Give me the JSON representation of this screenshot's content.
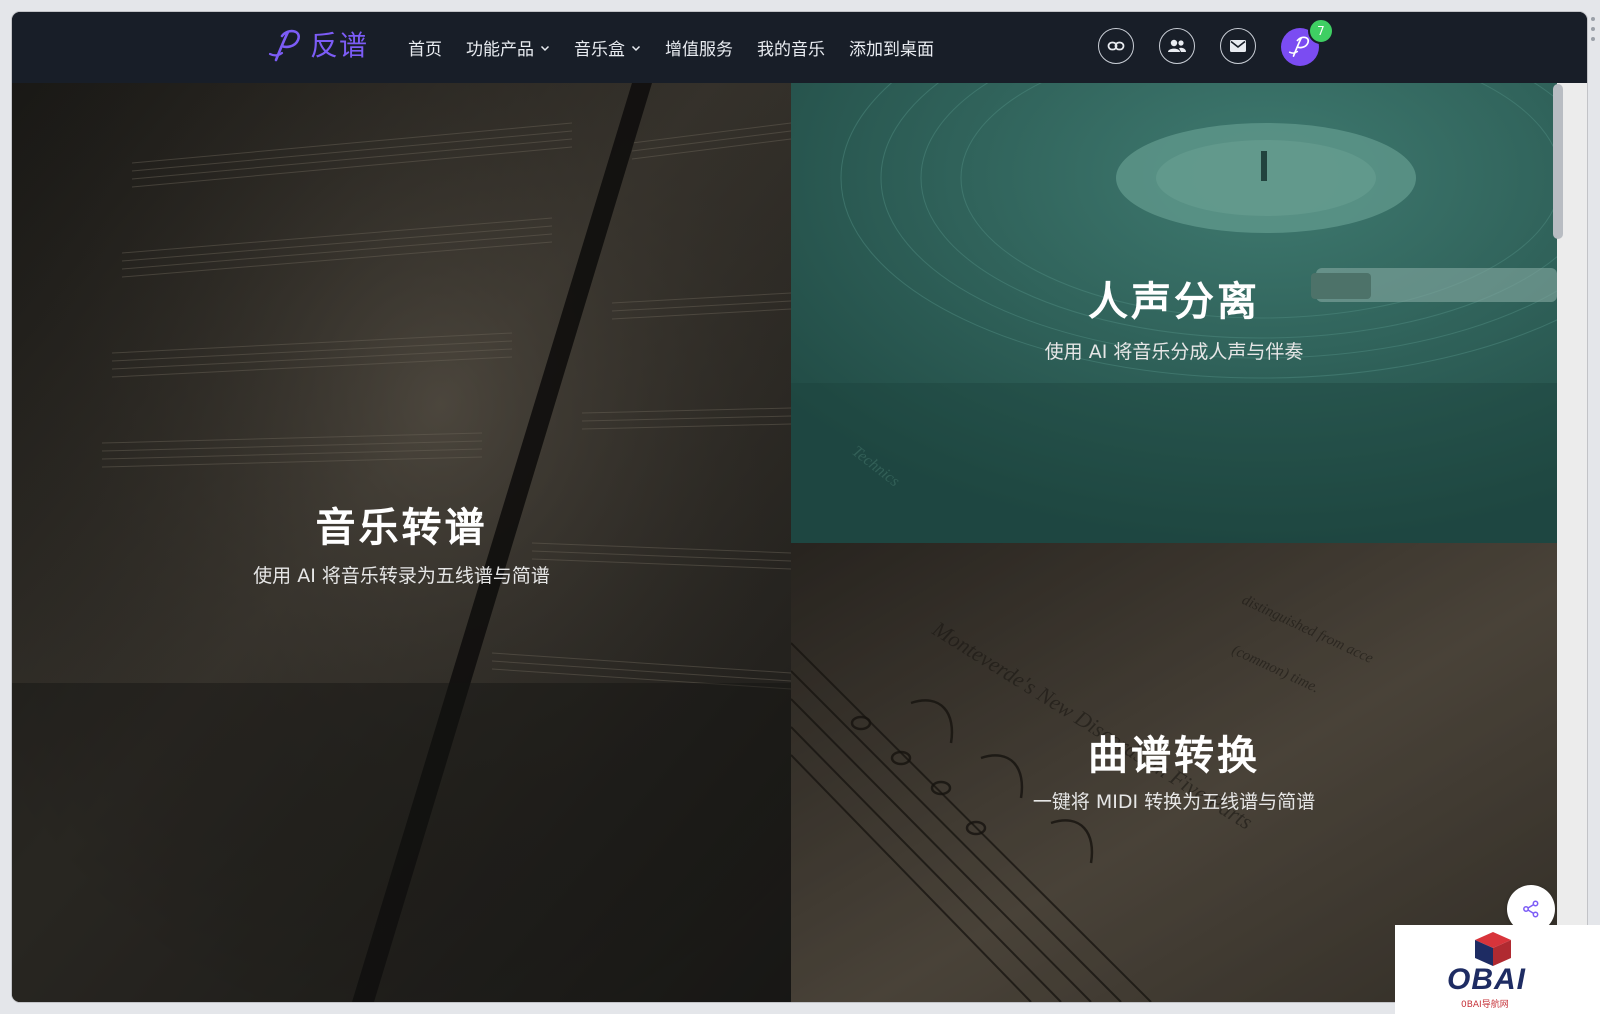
{
  "brand": {
    "logo_letter": "P",
    "name": "反谱",
    "color": "#7c5cf6"
  },
  "nav": {
    "items": [
      {
        "label": "首页",
        "has_dropdown": false
      },
      {
        "label": "功能产品",
        "has_dropdown": true
      },
      {
        "label": "音乐盒",
        "has_dropdown": true
      },
      {
        "label": "增值服务",
        "has_dropdown": false
      },
      {
        "label": "我的音乐",
        "has_dropdown": false
      },
      {
        "label": "添加到桌面",
        "has_dropdown": false
      }
    ]
  },
  "toolbar": {
    "icons": [
      "link-icon",
      "users-icon",
      "mail-icon"
    ],
    "notification_count": "7",
    "badge_color": "#3fcf63",
    "avatar_color": "#7b4cf2"
  },
  "features": {
    "transcription": {
      "title": "音乐转谱",
      "subtitle": "使用 AI 将音乐转录为五线谱与简谱"
    },
    "separation": {
      "title": "人声分离",
      "subtitle": "使用 AI 将音乐分成人声与伴奏"
    },
    "conversion": {
      "title": "曲谱转换",
      "subtitle": "一键将 MIDI 转换为五线谱与简谱"
    }
  },
  "watermark": {
    "text": "OBAI",
    "sub": "0BAI导航网"
  }
}
